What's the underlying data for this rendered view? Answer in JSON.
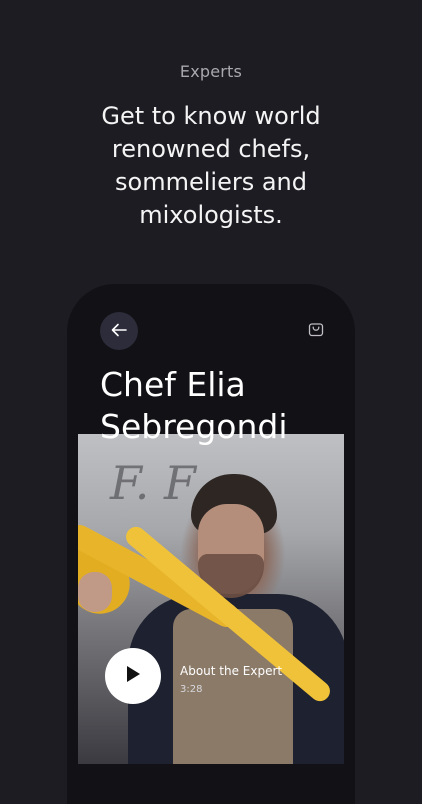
{
  "header": {
    "eyebrow": "Experts",
    "headline": "Get to know world renowned chefs, sommeliers and mixologists."
  },
  "phone": {
    "expert_name": "Chef Elia Sebregondi",
    "video": {
      "signature_text": "F. F",
      "title": "About the Expert",
      "duration": "3:28"
    },
    "icons": [
      "back-arrow-icon",
      "shopping-bag-icon",
      "play-icon"
    ]
  },
  "colors": {
    "background": "#1d1c22",
    "phone_background": "#121116",
    "back_button": "#2c2c3a",
    "pasta": "#e8b52a"
  }
}
